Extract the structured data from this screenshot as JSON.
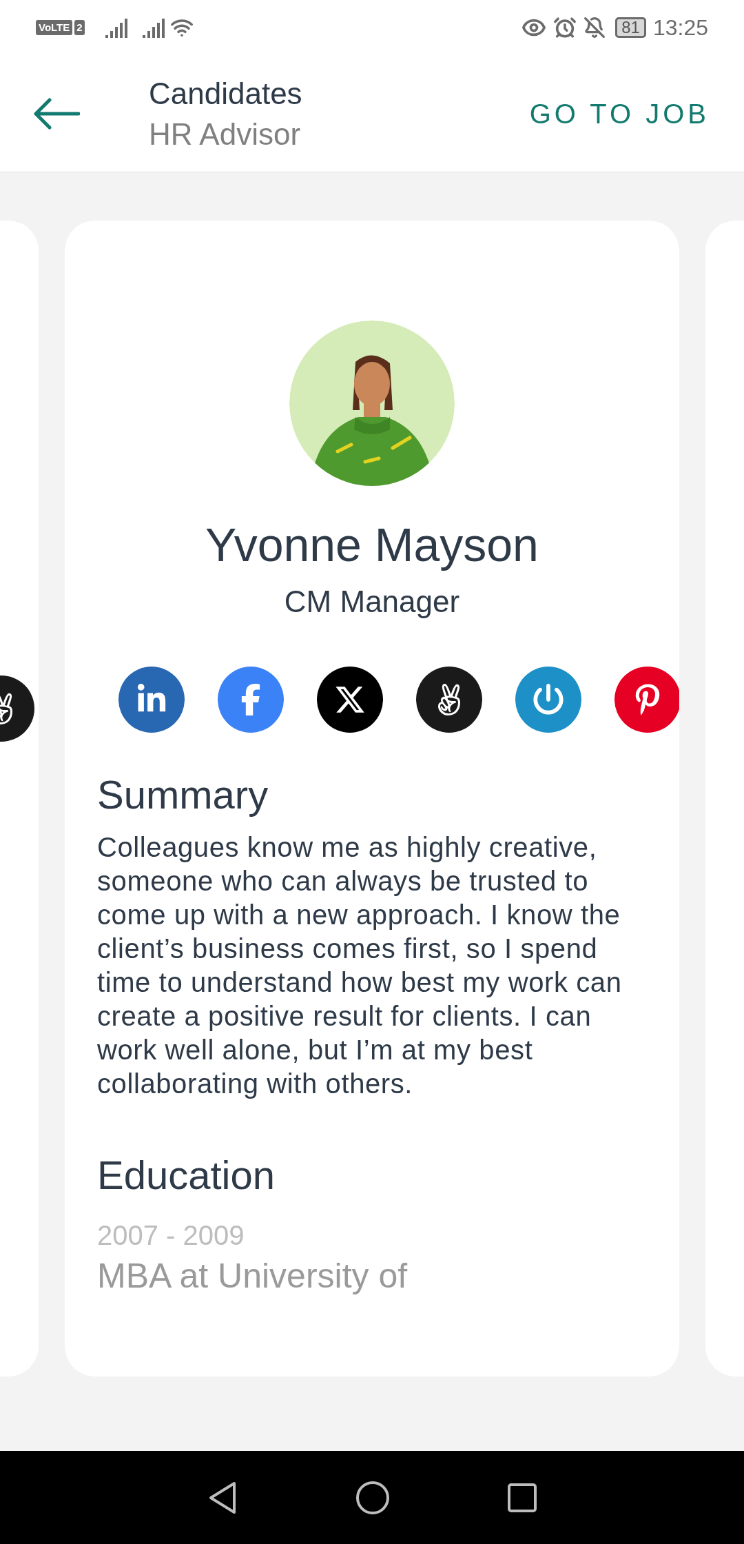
{
  "status_bar": {
    "volte": "VoLTE",
    "sim": "2",
    "battery": "81",
    "time": "13:25"
  },
  "header": {
    "title": "Candidates",
    "subtitle": "HR Advisor",
    "action": "GO TO JOB"
  },
  "candidate": {
    "name": "Yvonne Mayson",
    "role": "CM Manager",
    "socials": [
      {
        "kind": "linkedin"
      },
      {
        "kind": "facebook"
      },
      {
        "kind": "x"
      },
      {
        "kind": "angellist"
      },
      {
        "kind": "power"
      },
      {
        "kind": "pinterest"
      }
    ],
    "summary": {
      "heading": "Summary",
      "text": "Colleagues know me as highly creative, someone who can always be trusted to come up with a new approach. I know the client’s business comes first, so I spend time to understand how best my work can create a positive result for clients. I can work well alone, but I’m at my best collaborating with others."
    },
    "education": {
      "heading": "Education",
      "entries": [
        {
          "years": "2007 - 2009",
          "title": "MBA at University of"
        }
      ]
    }
  },
  "previous_card": {
    "socials": [
      {
        "kind": "angellist"
      }
    ]
  }
}
